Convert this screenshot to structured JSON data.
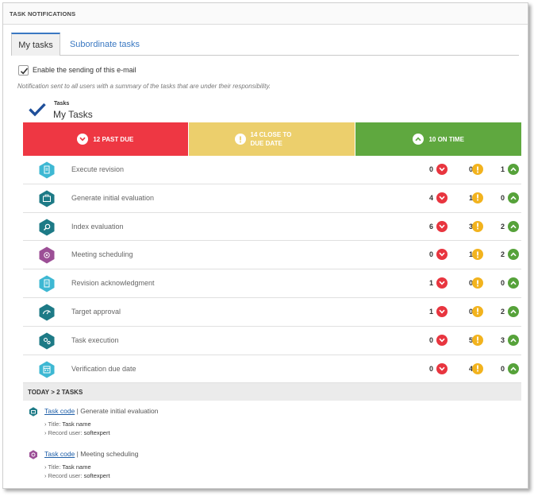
{
  "panel": {
    "title": "TASK NOTIFICATIONS"
  },
  "tabs": [
    {
      "label": "My tasks",
      "active": true
    },
    {
      "label": "Subordinate tasks",
      "active": false
    }
  ],
  "email_option": {
    "label": "Enable the sending of this e-mail",
    "checked": true
  },
  "note": "Notification sent to all users with a summary of the tasks that are under their responsibility.",
  "header": {
    "caption": "Tasks",
    "title": "My Tasks"
  },
  "summary": {
    "past_due": "12 PAST DUE",
    "close_line1": "14 CLOSE TO",
    "close_line2": "DUE DATE",
    "on_time": "10 ON TIME",
    "colors": {
      "past_due": "#ee3743",
      "close": "#eccf6c",
      "on_time": "#5fa83f"
    }
  },
  "tasks": [
    {
      "label": "Execute revision",
      "icon": "document-icon",
      "color": "#3eb8d3",
      "past_due": "0",
      "close": "0",
      "on_time": "1"
    },
    {
      "label": "Generate initial evaluation",
      "icon": "briefcase-icon",
      "color": "#1d7a86",
      "past_due": "4",
      "close": "1",
      "on_time": "0"
    },
    {
      "label": "Index evaluation",
      "icon": "magnifier-icon",
      "color": "#1d7a86",
      "past_due": "6",
      "close": "3",
      "on_time": "2"
    },
    {
      "label": "Meeting scheduling",
      "icon": "meeting-icon",
      "color": "#9c4f96",
      "past_due": "0",
      "close": "1",
      "on_time": "2"
    },
    {
      "label": "Revision acknowledgment",
      "icon": "document-icon",
      "color": "#3eb8d3",
      "past_due": "1",
      "close": "0",
      "on_time": "0"
    },
    {
      "label": "Target approval",
      "icon": "gauge-icon",
      "color": "#1d7a86",
      "past_due": "1",
      "close": "0",
      "on_time": "2"
    },
    {
      "label": "Task execution",
      "icon": "gears-icon",
      "color": "#1d7a86",
      "past_due": "0",
      "close": "5",
      "on_time": "3"
    },
    {
      "label": "Verification due date",
      "icon": "calendar-icon",
      "color": "#3eb8d3",
      "past_due": "0",
      "close": "4",
      "on_time": "0"
    }
  ],
  "today": {
    "header": "TODAY > 2 TASKS",
    "items": [
      {
        "link": "Task code",
        "separator": " | ",
        "name": "Generate initial evaluation",
        "title_label": "› Title: ",
        "title_value": "Task name",
        "user_label": "› Record user: ",
        "user_value": "softexpert",
        "icon": "briefcase-icon",
        "color": "#1d7a86"
      },
      {
        "link": "Task code",
        "separator": " | ",
        "name": "Meeting scheduling",
        "title_label": "› Title: ",
        "title_value": "Task name",
        "user_label": "› Record user: ",
        "user_value": "softexpert",
        "icon": "meeting-icon",
        "color": "#9c4f96"
      }
    ]
  }
}
